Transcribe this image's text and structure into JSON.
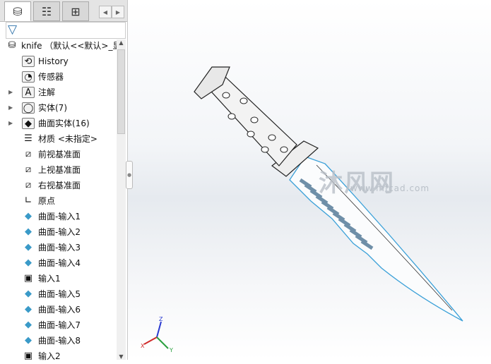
{
  "tabs": [
    {
      "icon": "feature-manager-icon"
    },
    {
      "icon": "property-manager-icon"
    },
    {
      "icon": "configuration-manager-icon"
    }
  ],
  "tree": {
    "root": "knife （默认<<默认>_显",
    "items": [
      {
        "label": "History",
        "icon": "history-folder-icon",
        "expand": false
      },
      {
        "label": "传感器",
        "icon": "sensor-folder-icon",
        "expand": false
      },
      {
        "label": "注解",
        "icon": "annotation-folder-icon",
        "expand": true
      },
      {
        "label": "实体(7)",
        "icon": "solid-bodies-folder-icon",
        "expand": true
      },
      {
        "label": "曲面实体(16)",
        "icon": "surface-bodies-folder-icon",
        "expand": true
      },
      {
        "label": "材质 <未指定>",
        "icon": "material-icon",
        "expand": false
      },
      {
        "label": "前视基准面",
        "icon": "plane-icon",
        "expand": false
      },
      {
        "label": "上视基准面",
        "icon": "plane-icon",
        "expand": false
      },
      {
        "label": "右视基准面",
        "icon": "plane-icon",
        "expand": false
      },
      {
        "label": "原点",
        "icon": "origin-icon",
        "expand": false
      },
      {
        "label": "曲面-输入1",
        "icon": "surface-icon",
        "expand": false
      },
      {
        "label": "曲面-输入2",
        "icon": "surface-icon",
        "expand": false
      },
      {
        "label": "曲面-输入3",
        "icon": "surface-icon",
        "expand": false
      },
      {
        "label": "曲面-输入4",
        "icon": "surface-icon",
        "expand": false
      },
      {
        "label": "输入1",
        "icon": "imported-body-icon",
        "expand": false
      },
      {
        "label": "曲面-输入5",
        "icon": "surface-icon",
        "expand": false
      },
      {
        "label": "曲面-输入6",
        "icon": "surface-icon",
        "expand": false
      },
      {
        "label": "曲面-输入7",
        "icon": "surface-icon",
        "expand": false
      },
      {
        "label": "曲面-输入8",
        "icon": "surface-icon",
        "expand": false
      },
      {
        "label": "输入2",
        "icon": "imported-body-icon",
        "expand": false
      }
    ]
  },
  "watermark": {
    "text": "沐风网",
    "url": "www.mfcad.com"
  },
  "triad": {
    "x": "X",
    "y": "Y",
    "z": "Z"
  },
  "colors": {
    "edge": "#3aa0d8",
    "surface": "#3a9ac8"
  }
}
